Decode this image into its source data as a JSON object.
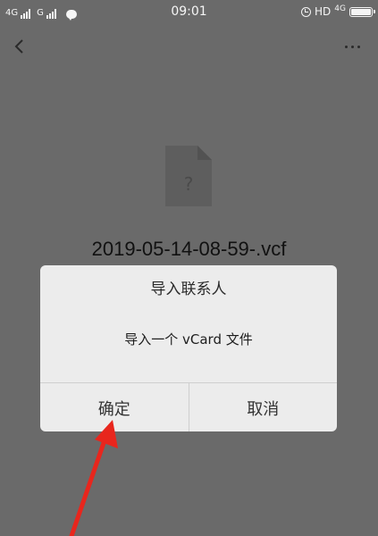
{
  "status_bar": {
    "network_1": "4G",
    "network_2": "G",
    "time": "09:01",
    "hd_label": "HD",
    "network_right": "4G"
  },
  "nav": {
    "back_icon": "chevron-left-icon",
    "more_icon": "more-horizontal-icon"
  },
  "file": {
    "icon": "unknown-file-icon",
    "icon_glyph": "?",
    "name": "2019-05-14-08-59-.vcf"
  },
  "dialog": {
    "title": "导入联系人",
    "message": "导入一个 vCard 文件",
    "confirm_label": "确定",
    "cancel_label": "取消"
  },
  "annotation": {
    "icon": "red-arrow-annotation",
    "color": "#e8261d"
  }
}
